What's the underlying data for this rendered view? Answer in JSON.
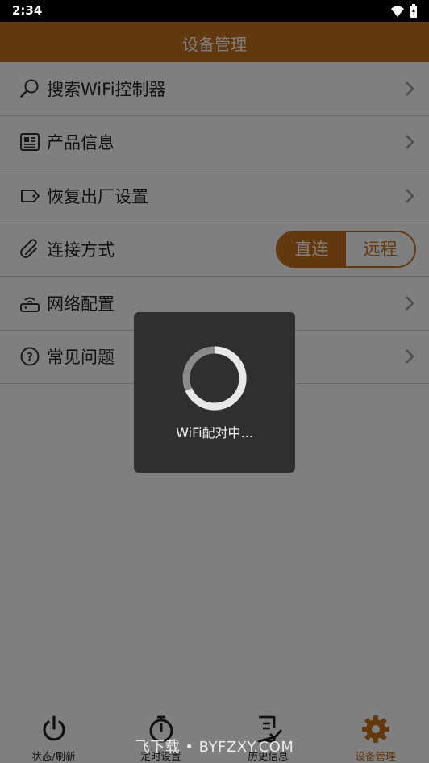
{
  "status_bar": {
    "time": "2:34"
  },
  "app_bar": {
    "title": "设备管理"
  },
  "menu": {
    "items": [
      {
        "label": "搜索WiFi控制器",
        "icon": "search-icon"
      },
      {
        "label": "产品信息",
        "icon": "newspaper-icon"
      },
      {
        "label": "恢复出厂设置",
        "icon": "tag-icon"
      },
      {
        "label": "连接方式",
        "icon": "paperclip-icon"
      },
      {
        "label": "网络配置",
        "icon": "router-icon"
      },
      {
        "label": "常见问题",
        "icon": "help-circle-icon"
      }
    ],
    "connection_mode": {
      "direct": "直连",
      "remote": "远程",
      "selected": "直连"
    }
  },
  "tabs": [
    {
      "label": "状态/刷新",
      "icon": "power-icon"
    },
    {
      "label": "定时设置",
      "icon": "stopwatch-icon"
    },
    {
      "label": "历史信息",
      "icon": "checklist-icon"
    },
    {
      "label": "设备管理",
      "icon": "gear-icon",
      "active": true
    }
  ],
  "loading_dialog": {
    "message": "WiFi配对中..."
  },
  "watermark": {
    "text": "飞下载 • BYFZXY.COM"
  },
  "colors": {
    "accent": "#c8701c",
    "dialog_bg": "#2f2f2f"
  }
}
